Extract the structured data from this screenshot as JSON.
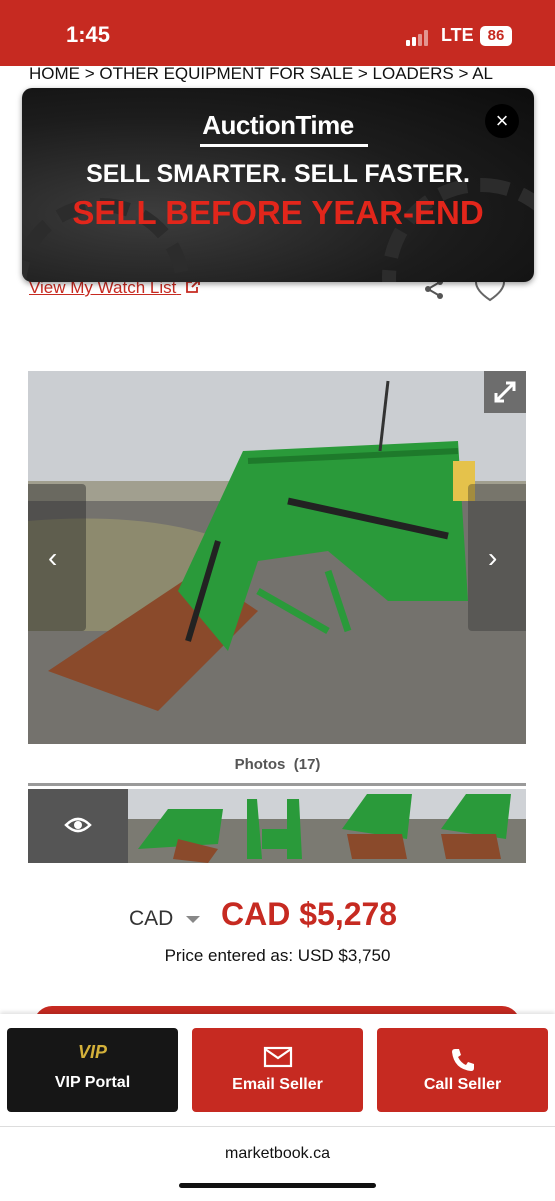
{
  "status_bar": {
    "time": "1:45",
    "network": "LTE",
    "battery": "86"
  },
  "breadcrumb": "HOME > OTHER EQUIPMENT FOR SALE > LOADERS > AL",
  "ad": {
    "brand": "AuctionTime",
    "headline": "SELL SMARTER. SELL FASTER.",
    "subheadline": "SELL BEFORE YEAR-END",
    "close_label": "×"
  },
  "watch_list": {
    "label": "View My Watch List"
  },
  "gallery": {
    "photos_label": "Photos",
    "photos_count": "(17)",
    "prev_label": "‹",
    "next_label": "›",
    "thumbnails": 5
  },
  "price": {
    "currency": "CAD",
    "value": "CAD $5,278",
    "entered_as": "Price entered as: USD $3,750"
  },
  "actions": {
    "vip_icon_text": "VIP",
    "vip_label": "VIP Portal",
    "email_label": "Email Seller",
    "call_label": "Call Seller"
  },
  "footer": {
    "domain": "marketbook.ca"
  },
  "colors": {
    "brand_red": "#c62a21",
    "dark": "#161616",
    "ad_red": "#e2261b",
    "equipment_green": "#2a9a3a"
  }
}
